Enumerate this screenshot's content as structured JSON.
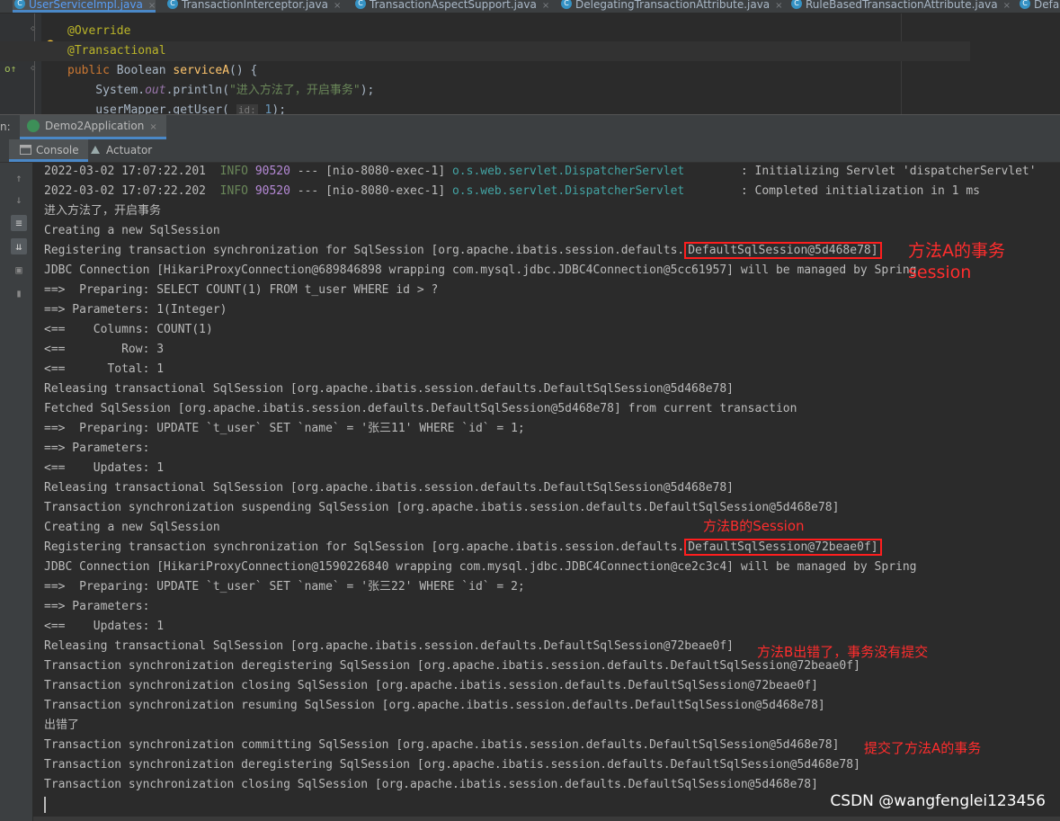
{
  "editor_tabs": [
    {
      "label": "UserServiceImpl.java",
      "active": true
    },
    {
      "label": "TransactionInterceptor.java",
      "active": false
    },
    {
      "label": "TransactionAspectSupport.java",
      "active": false
    },
    {
      "label": "DelegatingTransactionAttribute.java",
      "active": false
    },
    {
      "label": "RuleBasedTransactionAttribute.java",
      "active": false
    },
    {
      "label": "Defau",
      "active": false
    }
  ],
  "tab_close_glyph": "×",
  "code": {
    "line1": "@Override",
    "line2": "@Transactional",
    "line3_kw": "public",
    "line3_type": " Boolean ",
    "line3_fn": "serviceA",
    "line3_rest": "() {",
    "line4_pre": "    System.",
    "line4_out": "out",
    "line4_mid": ".println(",
    "line4_str": "\"进入方法了，开启事务\"",
    "line4_end": ");",
    "line5_pre": "    userMapper.getUser( ",
    "line5_hint": "id:",
    "line5_num": " 1",
    "line5_end": ");"
  },
  "run_window": {
    "label": "n:",
    "config_tab": "Demo2Application",
    "subtabs": [
      "Console",
      "Actuator"
    ]
  },
  "console": {
    "log1": {
      "ts": "2022-03-02 17:07:22.201",
      "level": "INFO",
      "pid": "90520",
      "mid": " --- [nio-8080-exec-1] ",
      "logger": "o.s.web.servlet.DispatcherServlet",
      "msg": "        : Initializing Servlet 'dispatcherServlet'"
    },
    "log2": {
      "ts": "2022-03-02 17:07:22.202",
      "level": "INFO",
      "pid": "90520",
      "mid": " --- [nio-8080-exec-1] ",
      "logger": "o.s.web.servlet.DispatcherServlet",
      "msg": "        : Completed initialization in 1 ms"
    },
    "l3": "进入方法了，开启事务",
    "l4": "Creating a new SqlSession",
    "l5_pre": "Registering transaction synchronization for SqlSession [org.apache.ibatis.session.defaults.",
    "l5_box": "DefaultSqlSession@5d468e78]",
    "l6": "JDBC Connection [HikariProxyConnection@689846898 wrapping com.mysql.jdbc.JDBC4Connection@5cc61957] will be managed by Spring",
    "l7": "==>  Preparing: SELECT COUNT(1) FROM t_user WHERE id > ?",
    "l8": "==> Parameters: 1(Integer)",
    "l9": "<==    Columns: COUNT(1)",
    "l10": "<==        Row: 3",
    "l11": "<==      Total: 1",
    "l12": "Releasing transactional SqlSession [org.apache.ibatis.session.defaults.DefaultSqlSession@5d468e78]",
    "l13": "Fetched SqlSession [org.apache.ibatis.session.defaults.DefaultSqlSession@5d468e78] from current transaction",
    "l14": "==>  Preparing: UPDATE `t_user` SET `name` = '张三11' WHERE `id` = 1;",
    "l15": "==> Parameters: ",
    "l16": "<==    Updates: 1",
    "l17": "Releasing transactional SqlSession [org.apache.ibatis.session.defaults.DefaultSqlSession@5d468e78]",
    "l18": "Transaction synchronization suspending SqlSession [org.apache.ibatis.session.defaults.DefaultSqlSession@5d468e78]",
    "l19": "Creating a new SqlSession",
    "l20_pre": "Registering transaction synchronization for SqlSession [org.apache.ibatis.session.defaults.",
    "l20_box": "DefaultSqlSession@72beae0f]",
    "l21": "JDBC Connection [HikariProxyConnection@1590226840 wrapping com.mysql.jdbc.JDBC4Connection@ce2c3c4] will be managed by Spring",
    "l22": "==>  Preparing: UPDATE `t_user` SET `name` = '张三22' WHERE `id` = 2;",
    "l23": "==> Parameters: ",
    "l24": "<==    Updates: 1",
    "l25": "Releasing transactional SqlSession [org.apache.ibatis.session.defaults.DefaultSqlSession@72beae0f]",
    "l26": "Transaction synchronization deregistering SqlSession [org.apache.ibatis.session.defaults.DefaultSqlSession@72beae0f]",
    "l27": "Transaction synchronization closing SqlSession [org.apache.ibatis.session.defaults.DefaultSqlSession@72beae0f]",
    "l28": "Transaction synchronization resuming SqlSession [org.apache.ibatis.session.defaults.DefaultSqlSession@5d468e78]",
    "l29": "出错了",
    "l30": "Transaction synchronization committing SqlSession [org.apache.ibatis.session.defaults.DefaultSqlSession@5d468e78]",
    "l31": "Transaction synchronization deregistering SqlSession [org.apache.ibatis.session.defaults.DefaultSqlSession@5d468e78]",
    "l32": "Transaction synchronization closing SqlSession [org.apache.ibatis.session.defaults.DefaultSqlSession@5d468e78]"
  },
  "annotations": {
    "a_session_line1": "方法A的事务",
    "a_session_line2": "session",
    "b_session": "方法B的Session",
    "b_error": "方法B出错了，事务没有提交",
    "a_commit": "提交了方法A的事务"
  },
  "watermark": "CSDN @wangfenglei123456",
  "colors": {
    "annotation_red": "#ff2d2d",
    "accent_blue": "#4a88c7",
    "log_info_green": "#6a8759",
    "logger_teal": "#43a3a3"
  }
}
